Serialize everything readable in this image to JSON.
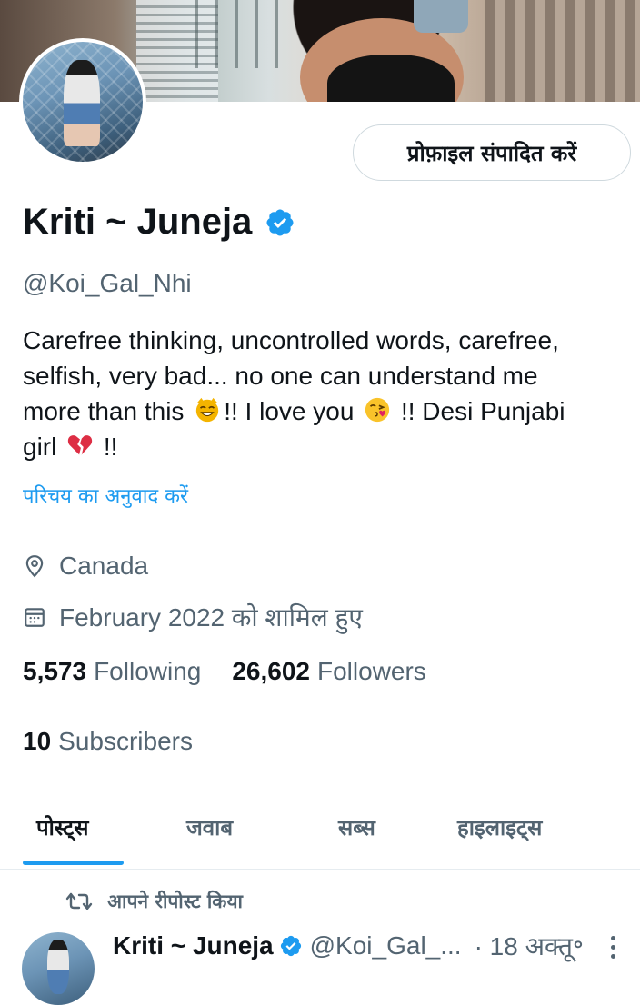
{
  "profile": {
    "edit_button": "प्रोफ़ाइल संपादित करें",
    "name": "Kriti ~ Juneja",
    "handle": "@Koi_Gal_Nhi",
    "bio": {
      "line1": "Carefree thinking, uncontrolled words, carefree,",
      "line2": "selfish, very bad... no one can understand me",
      "line3a": "more than this ",
      "line3b": "!! I love you ",
      "line3c": " !! Desi Punjabi",
      "line4a": "girl ",
      "line4b": " !!"
    },
    "translate_bio": "परिचय का अनुवाद करें",
    "location": "Canada",
    "joined": "February 2022 को शामिल हुए",
    "following_count": "5,573",
    "following_label": "Following",
    "followers_count": "26,602",
    "followers_label": "Followers",
    "subscribers_count": "10",
    "subscribers_label": "Subscribers"
  },
  "tabs": [
    {
      "label": "पोस्ट्स",
      "active": true
    },
    {
      "label": "जवाब",
      "active": false
    },
    {
      "label": "सब्स",
      "active": false
    },
    {
      "label": "हाइलाइट्स",
      "active": false
    }
  ],
  "feed": {
    "repost_label": "आपने रीपोस्ट किया",
    "post": {
      "name": "Kriti ~ Juneja",
      "handle": "@Koi_Gal_...",
      "date": "· 18 अक्तू॰"
    }
  },
  "colors": {
    "accent": "#1d9bf0",
    "text": "#0f1419",
    "muted": "#536471",
    "border": "#cfd9de"
  },
  "icons": [
    "verified-badge-icon",
    "location-pin-icon",
    "calendar-icon",
    "repost-icon",
    "more-options-icon",
    "cat-emoji-icon",
    "kiss-emoji-icon",
    "broken-heart-icon"
  ]
}
